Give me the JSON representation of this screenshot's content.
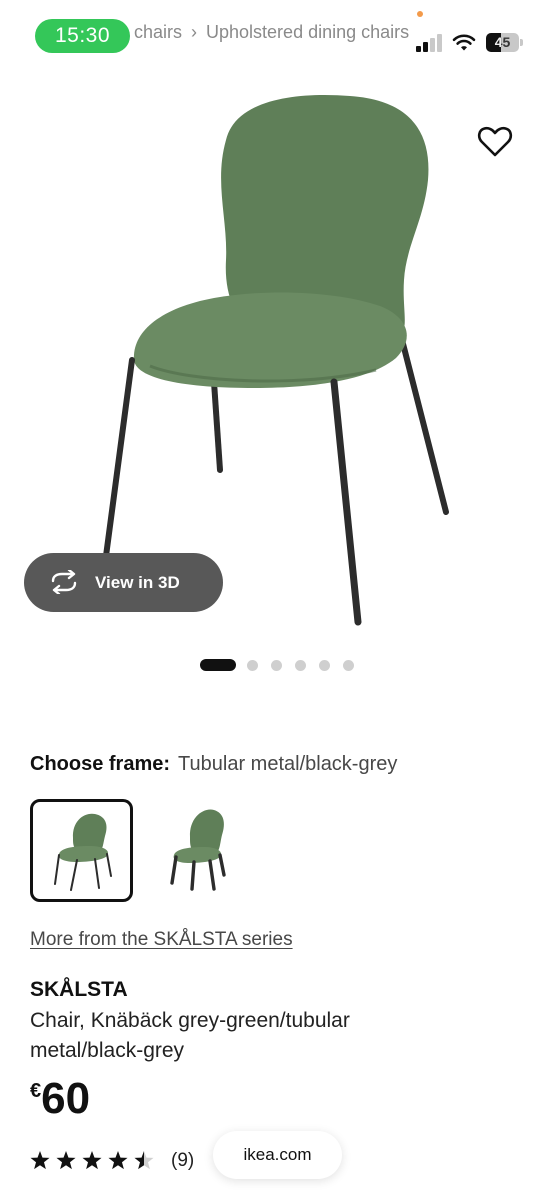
{
  "status_bar": {
    "time": "15:30",
    "battery_level": "45",
    "battery_fraction": 0.45,
    "signal_bars_active": 2,
    "signal_bars_total": 4
  },
  "breadcrumb": [
    "chairs",
    "Upholstered dining chairs"
  ],
  "breadcrumb_separator": "›",
  "product_image": {
    "view_3d_label": "View in 3D",
    "chair_colors": {
      "upholstery": "#5f7f58",
      "frame": "#2c2c2c"
    }
  },
  "carousel": {
    "count": 6,
    "active_index": 0
  },
  "frame_choice": {
    "label": "Choose frame:",
    "value": "Tubular metal/black-grey",
    "options_count": 2,
    "selected_index": 0
  },
  "series_link": "More from the SKÅLSTA series",
  "product": {
    "name": "SKÅLSTA",
    "description": "Chair, Knäbäck grey-green/tubular metal/black-grey",
    "currency_symbol": "€",
    "price": "60"
  },
  "rating": {
    "value": 4.5,
    "max": 5,
    "count_label": "(9)"
  },
  "browser": {
    "url": "ikea.com"
  }
}
